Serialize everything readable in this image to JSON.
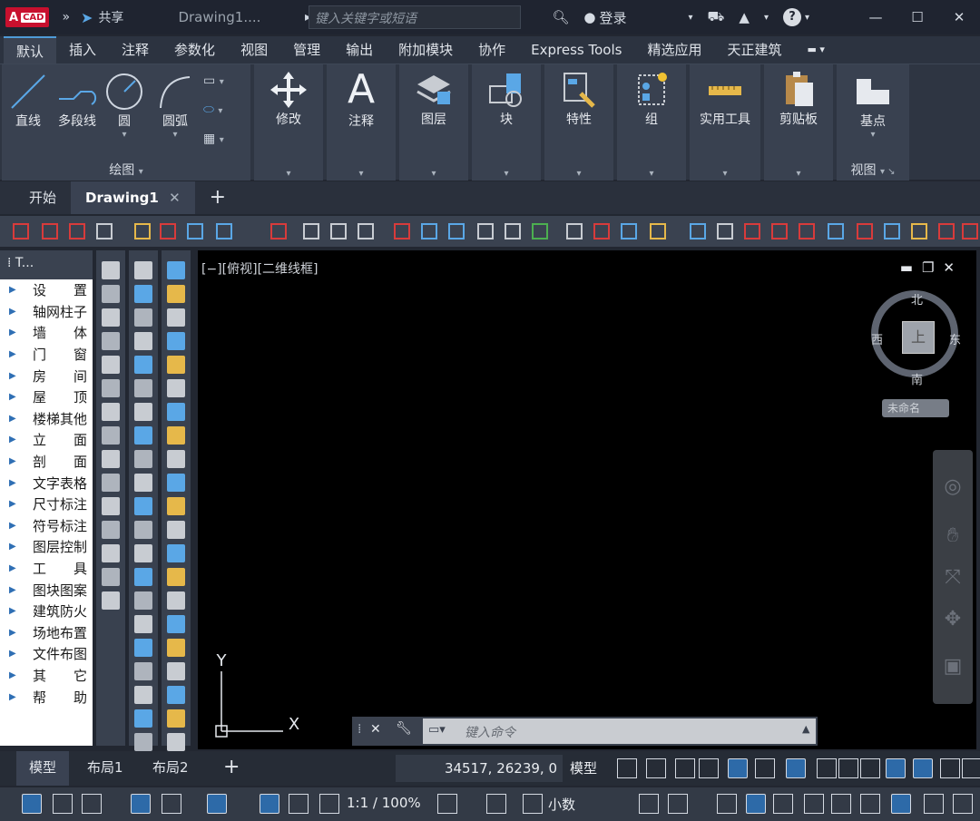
{
  "titlebar": {
    "logo_text": "A",
    "logo_sub": "CAD",
    "share": "共享",
    "doc_title": "Drawing1....",
    "search_placeholder": "键入关键字或短语",
    "login": "登录"
  },
  "ribbon_tabs": [
    "默认",
    "插入",
    "注释",
    "参数化",
    "视图",
    "管理",
    "输出",
    "附加模块",
    "协作",
    "Express Tools",
    "精选应用",
    "天正建筑"
  ],
  "ribbon": {
    "draw_buttons": [
      "直线",
      "多段线",
      "圆",
      "圆弧"
    ],
    "draw_group": "绘图",
    "big_buttons": [
      "修改",
      "注释",
      "图层",
      "块",
      "特性",
      "组",
      "实用工具",
      "剪贴板"
    ],
    "basepoint": "基点",
    "view_group": "视图"
  },
  "doc_tabs": {
    "start": "开始",
    "drawing": "Drawing1"
  },
  "palette": {
    "title": "T...",
    "items": [
      "设　　置",
      "轴网柱子",
      "墙　　体",
      "门　　窗",
      "房　　间",
      "屋　　顶",
      "楼梯其他",
      "立　　面",
      "剖　　面",
      "文字表格",
      "尺寸标注",
      "符号标注",
      "图层控制",
      "工　　具",
      "图块图案",
      "建筑防火",
      "场地布置",
      "文件布图",
      "其　　它",
      "帮　　助"
    ]
  },
  "viewport": {
    "label": "[−][俯视][二维线框]",
    "compass": {
      "north": "北",
      "south": "南",
      "east": "东",
      "west": "西",
      "cube": "上"
    },
    "unnamed": "未命名",
    "ucs_y": "Y",
    "ucs_x": "X"
  },
  "cmdline": {
    "placeholder": "键入命令"
  },
  "layout_tabs": [
    "模型",
    "布局1",
    "布局2"
  ],
  "status": {
    "coords": "34517, 26239, 0",
    "model": "模型",
    "scale": "1:1 / 100%",
    "units": "小数"
  },
  "colors": {
    "accent": "#2d6aa8",
    "bg": "#222731",
    "viewport": "#000000"
  }
}
